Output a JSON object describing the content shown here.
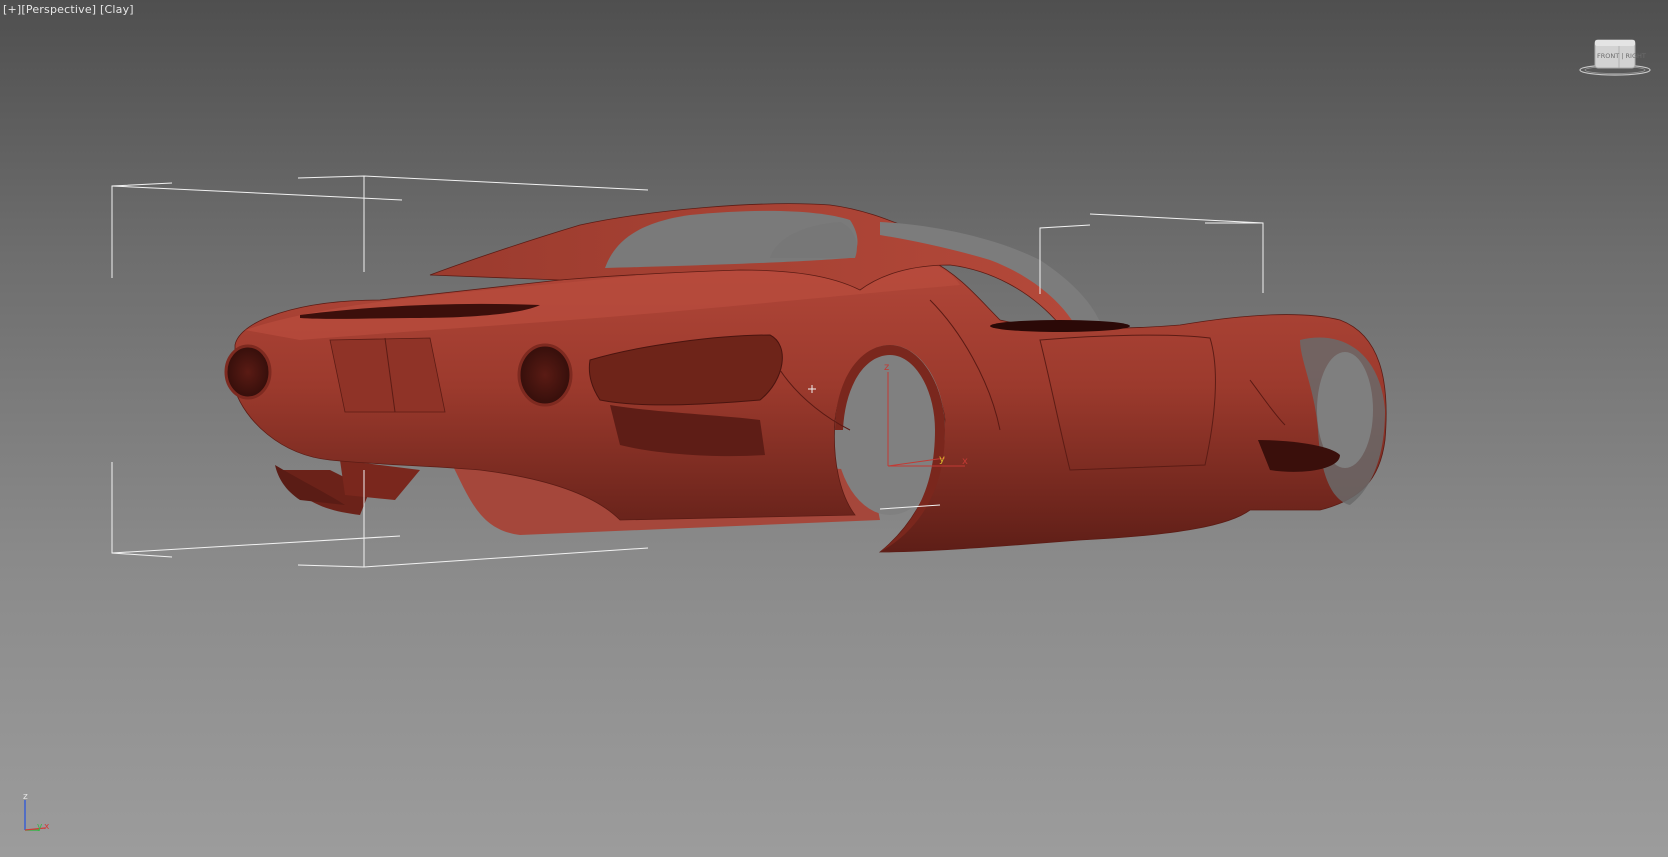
{
  "viewport": {
    "menus": [
      "[+]",
      "[Perspective]",
      "[Clay]"
    ],
    "background_top": "#4f4f4f",
    "background_bottom": "#9c9c9c"
  },
  "viewcube": {
    "icon": "viewcube-icon",
    "face_label": "FRONT | RIGHT"
  },
  "gizmo": {
    "z_label": "z",
    "y_label": "y",
    "x_label": "x"
  },
  "world_axis": {
    "z_label": "z",
    "y_label": "y",
    "x_label": "x",
    "colors": {
      "x": "#d23a3a",
      "y": "#39b54a",
      "z": "#3a5fd2"
    }
  },
  "model": {
    "icon": "car-body-icon",
    "material_color": "#a63a2c",
    "selection_box_color": "#f2f2f2"
  }
}
